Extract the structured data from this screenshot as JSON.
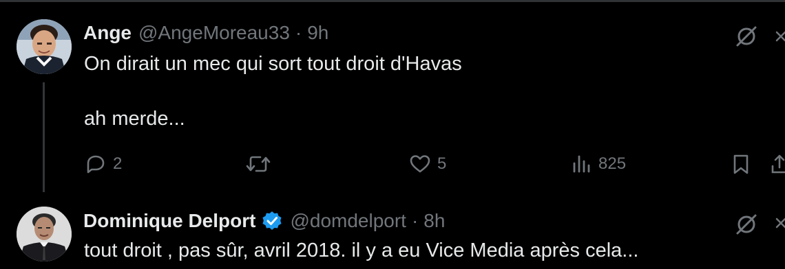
{
  "tweets": [
    {
      "display_name": "Ange",
      "handle": "@AngeMoreau33",
      "separator": "·",
      "time": "9h",
      "verified": false,
      "text": "On dirait un mec qui sort tout droit d'Havas\n\nah merde...",
      "replies": "2",
      "retweets": "",
      "likes": "5",
      "views": "825"
    },
    {
      "display_name": "Dominique Delport",
      "handle": "@domdelport",
      "separator": "·",
      "time": "8h",
      "verified": true,
      "text": "tout droit , pas sûr, avril 2018. il y a eu Vice Media après cela..."
    }
  ],
  "icons": {
    "reply": "reply-icon",
    "retweet": "retweet-icon",
    "like": "heart-icon",
    "views": "views-icon",
    "bookmark": "bookmark-icon",
    "share": "share-icon",
    "more": "grok-icon",
    "verified": "verified-badge-icon"
  },
  "colors": {
    "background": "#000000",
    "text_primary": "#e7e9ea",
    "text_secondary": "#71767b",
    "verified_blue": "#1d9bf0",
    "divider": "#2f3336"
  }
}
